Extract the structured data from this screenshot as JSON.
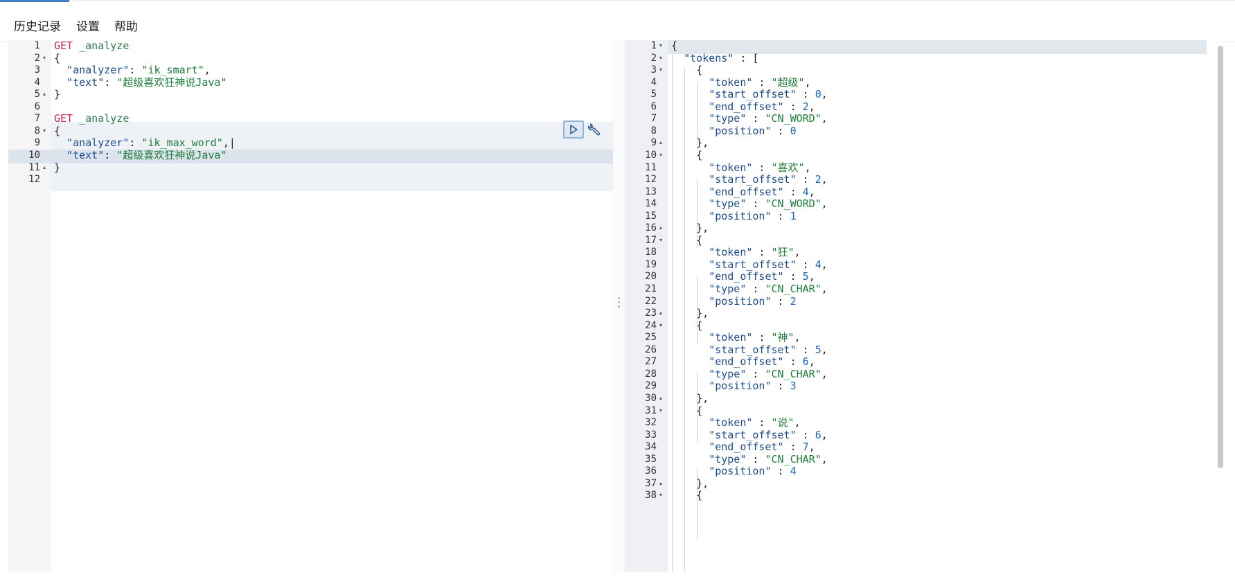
{
  "menu": {
    "history": "历史记录",
    "settings": "设置",
    "help": "帮助"
  },
  "request": {
    "lines": [
      {
        "n": "1",
        "fold": "",
        "tokens": [
          [
            "tk-method",
            "GET"
          ],
          [
            "tk-punc",
            " "
          ],
          [
            "tk-url",
            "_analyze"
          ]
        ]
      },
      {
        "n": "2",
        "fold": "▾",
        "tokens": [
          [
            "tk-punc",
            "{"
          ]
        ]
      },
      {
        "n": "3",
        "fold": "",
        "tokens": [
          [
            "tk-punc",
            "  "
          ],
          [
            "tk-key",
            "\"analyzer\""
          ],
          [
            "tk-punc",
            ": "
          ],
          [
            "tk-str",
            "\"ik_smart\""
          ],
          [
            "tk-punc",
            ","
          ]
        ]
      },
      {
        "n": "4",
        "fold": "",
        "tokens": [
          [
            "tk-punc",
            "  "
          ],
          [
            "tk-key",
            "\"text\""
          ],
          [
            "tk-punc",
            ": "
          ],
          [
            "tk-str",
            "\"超级喜欢狂神说Java\""
          ]
        ]
      },
      {
        "n": "5",
        "fold": "▴",
        "tokens": [
          [
            "tk-punc",
            "}"
          ]
        ]
      },
      {
        "n": "6",
        "fold": "",
        "tokens": []
      },
      {
        "n": "7",
        "fold": "",
        "tokens": [
          [
            "tk-method",
            "GET"
          ],
          [
            "tk-punc",
            " "
          ],
          [
            "tk-url",
            "_analyze"
          ]
        ]
      },
      {
        "n": "8",
        "fold": "▾",
        "tokens": [
          [
            "tk-punc",
            "{"
          ]
        ]
      },
      {
        "n": "9",
        "fold": "",
        "tokens": [
          [
            "tk-punc",
            "  "
          ],
          [
            "tk-key",
            "\"analyzer\""
          ],
          [
            "tk-punc",
            ": "
          ],
          [
            "tk-str",
            "\"ik_max_word\""
          ],
          [
            "tk-punc",
            ",|"
          ]
        ]
      },
      {
        "n": "10",
        "fold": "",
        "tokens": [
          [
            "tk-punc",
            "  "
          ],
          [
            "tk-key",
            "\"text\""
          ],
          [
            "tk-punc",
            ": "
          ],
          [
            "tk-str",
            "\"超级喜欢狂神说Java\""
          ]
        ]
      },
      {
        "n": "11",
        "fold": "▴",
        "tokens": [
          [
            "tk-punc",
            "}"
          ]
        ]
      },
      {
        "n": "12",
        "fold": "",
        "tokens": []
      }
    ]
  },
  "response": {
    "lines": [
      {
        "n": "1",
        "fold": "▾",
        "tokens": [
          [
            "tk-punc",
            "{"
          ]
        ]
      },
      {
        "n": "2",
        "fold": "▾",
        "tokens": [
          [
            "tk-punc",
            "  "
          ],
          [
            "tk-key",
            "\"tokens\""
          ],
          [
            "tk-punc",
            " : ["
          ]
        ]
      },
      {
        "n": "3",
        "fold": "▾",
        "tokens": [
          [
            "tk-punc",
            "    {"
          ]
        ]
      },
      {
        "n": "4",
        "fold": "",
        "tokens": [
          [
            "tk-punc",
            "      "
          ],
          [
            "tk-key",
            "\"token\""
          ],
          [
            "tk-punc",
            " : "
          ],
          [
            "tk-str",
            "\"超级\""
          ],
          [
            "tk-punc",
            ","
          ]
        ]
      },
      {
        "n": "5",
        "fold": "",
        "tokens": [
          [
            "tk-punc",
            "      "
          ],
          [
            "tk-key",
            "\"start_offset\""
          ],
          [
            "tk-punc",
            " : "
          ],
          [
            "tk-num",
            "0"
          ],
          [
            "tk-punc",
            ","
          ]
        ]
      },
      {
        "n": "6",
        "fold": "",
        "tokens": [
          [
            "tk-punc",
            "      "
          ],
          [
            "tk-key",
            "\"end_offset\""
          ],
          [
            "tk-punc",
            " : "
          ],
          [
            "tk-num",
            "2"
          ],
          [
            "tk-punc",
            ","
          ]
        ]
      },
      {
        "n": "7",
        "fold": "",
        "tokens": [
          [
            "tk-punc",
            "      "
          ],
          [
            "tk-key",
            "\"type\""
          ],
          [
            "tk-punc",
            " : "
          ],
          [
            "tk-str",
            "\"CN_WORD\""
          ],
          [
            "tk-punc",
            ","
          ]
        ]
      },
      {
        "n": "8",
        "fold": "",
        "tokens": [
          [
            "tk-punc",
            "      "
          ],
          [
            "tk-key",
            "\"position\""
          ],
          [
            "tk-punc",
            " : "
          ],
          [
            "tk-num",
            "0"
          ]
        ]
      },
      {
        "n": "9",
        "fold": "▴",
        "tokens": [
          [
            "tk-punc",
            "    },"
          ]
        ]
      },
      {
        "n": "10",
        "fold": "▾",
        "tokens": [
          [
            "tk-punc",
            "    {"
          ]
        ]
      },
      {
        "n": "11",
        "fold": "",
        "tokens": [
          [
            "tk-punc",
            "      "
          ],
          [
            "tk-key",
            "\"token\""
          ],
          [
            "tk-punc",
            " : "
          ],
          [
            "tk-str",
            "\"喜欢\""
          ],
          [
            "tk-punc",
            ","
          ]
        ]
      },
      {
        "n": "12",
        "fold": "",
        "tokens": [
          [
            "tk-punc",
            "      "
          ],
          [
            "tk-key",
            "\"start_offset\""
          ],
          [
            "tk-punc",
            " : "
          ],
          [
            "tk-num",
            "2"
          ],
          [
            "tk-punc",
            ","
          ]
        ]
      },
      {
        "n": "13",
        "fold": "",
        "tokens": [
          [
            "tk-punc",
            "      "
          ],
          [
            "tk-key",
            "\"end_offset\""
          ],
          [
            "tk-punc",
            " : "
          ],
          [
            "tk-num",
            "4"
          ],
          [
            "tk-punc",
            ","
          ]
        ]
      },
      {
        "n": "14",
        "fold": "",
        "tokens": [
          [
            "tk-punc",
            "      "
          ],
          [
            "tk-key",
            "\"type\""
          ],
          [
            "tk-punc",
            " : "
          ],
          [
            "tk-str",
            "\"CN_WORD\""
          ],
          [
            "tk-punc",
            ","
          ]
        ]
      },
      {
        "n": "15",
        "fold": "",
        "tokens": [
          [
            "tk-punc",
            "      "
          ],
          [
            "tk-key",
            "\"position\""
          ],
          [
            "tk-punc",
            " : "
          ],
          [
            "tk-num",
            "1"
          ]
        ]
      },
      {
        "n": "16",
        "fold": "▴",
        "tokens": [
          [
            "tk-punc",
            "    },"
          ]
        ]
      },
      {
        "n": "17",
        "fold": "▾",
        "tokens": [
          [
            "tk-punc",
            "    {"
          ]
        ]
      },
      {
        "n": "18",
        "fold": "",
        "tokens": [
          [
            "tk-punc",
            "      "
          ],
          [
            "tk-key",
            "\"token\""
          ],
          [
            "tk-punc",
            " : "
          ],
          [
            "tk-str",
            "\"狂\""
          ],
          [
            "tk-punc",
            ","
          ]
        ]
      },
      {
        "n": "19",
        "fold": "",
        "tokens": [
          [
            "tk-punc",
            "      "
          ],
          [
            "tk-key",
            "\"start_offset\""
          ],
          [
            "tk-punc",
            " : "
          ],
          [
            "tk-num",
            "4"
          ],
          [
            "tk-punc",
            ","
          ]
        ]
      },
      {
        "n": "20",
        "fold": "",
        "tokens": [
          [
            "tk-punc",
            "      "
          ],
          [
            "tk-key",
            "\"end_offset\""
          ],
          [
            "tk-punc",
            " : "
          ],
          [
            "tk-num",
            "5"
          ],
          [
            "tk-punc",
            ","
          ]
        ]
      },
      {
        "n": "21",
        "fold": "",
        "tokens": [
          [
            "tk-punc",
            "      "
          ],
          [
            "tk-key",
            "\"type\""
          ],
          [
            "tk-punc",
            " : "
          ],
          [
            "tk-str",
            "\"CN_CHAR\""
          ],
          [
            "tk-punc",
            ","
          ]
        ]
      },
      {
        "n": "22",
        "fold": "",
        "tokens": [
          [
            "tk-punc",
            "      "
          ],
          [
            "tk-key",
            "\"position\""
          ],
          [
            "tk-punc",
            " : "
          ],
          [
            "tk-num",
            "2"
          ]
        ]
      },
      {
        "n": "23",
        "fold": "▴",
        "tokens": [
          [
            "tk-punc",
            "    },"
          ]
        ]
      },
      {
        "n": "24",
        "fold": "▾",
        "tokens": [
          [
            "tk-punc",
            "    {"
          ]
        ]
      },
      {
        "n": "25",
        "fold": "",
        "tokens": [
          [
            "tk-punc",
            "      "
          ],
          [
            "tk-key",
            "\"token\""
          ],
          [
            "tk-punc",
            " : "
          ],
          [
            "tk-str",
            "\"神\""
          ],
          [
            "tk-punc",
            ","
          ]
        ]
      },
      {
        "n": "26",
        "fold": "",
        "tokens": [
          [
            "tk-punc",
            "      "
          ],
          [
            "tk-key",
            "\"start_offset\""
          ],
          [
            "tk-punc",
            " : "
          ],
          [
            "tk-num",
            "5"
          ],
          [
            "tk-punc",
            ","
          ]
        ]
      },
      {
        "n": "27",
        "fold": "",
        "tokens": [
          [
            "tk-punc",
            "      "
          ],
          [
            "tk-key",
            "\"end_offset\""
          ],
          [
            "tk-punc",
            " : "
          ],
          [
            "tk-num",
            "6"
          ],
          [
            "tk-punc",
            ","
          ]
        ]
      },
      {
        "n": "28",
        "fold": "",
        "tokens": [
          [
            "tk-punc",
            "      "
          ],
          [
            "tk-key",
            "\"type\""
          ],
          [
            "tk-punc",
            " : "
          ],
          [
            "tk-str",
            "\"CN_CHAR\""
          ],
          [
            "tk-punc",
            ","
          ]
        ]
      },
      {
        "n": "29",
        "fold": "",
        "tokens": [
          [
            "tk-punc",
            "      "
          ],
          [
            "tk-key",
            "\"position\""
          ],
          [
            "tk-punc",
            " : "
          ],
          [
            "tk-num",
            "3"
          ]
        ]
      },
      {
        "n": "30",
        "fold": "▴",
        "tokens": [
          [
            "tk-punc",
            "    },"
          ]
        ]
      },
      {
        "n": "31",
        "fold": "▾",
        "tokens": [
          [
            "tk-punc",
            "    {"
          ]
        ]
      },
      {
        "n": "32",
        "fold": "",
        "tokens": [
          [
            "tk-punc",
            "      "
          ],
          [
            "tk-key",
            "\"token\""
          ],
          [
            "tk-punc",
            " : "
          ],
          [
            "tk-str",
            "\"说\""
          ],
          [
            "tk-punc",
            ","
          ]
        ]
      },
      {
        "n": "33",
        "fold": "",
        "tokens": [
          [
            "tk-punc",
            "      "
          ],
          [
            "tk-key",
            "\"start_offset\""
          ],
          [
            "tk-punc",
            " : "
          ],
          [
            "tk-num",
            "6"
          ],
          [
            "tk-punc",
            ","
          ]
        ]
      },
      {
        "n": "34",
        "fold": "",
        "tokens": [
          [
            "tk-punc",
            "      "
          ],
          [
            "tk-key",
            "\"end_offset\""
          ],
          [
            "tk-punc",
            " : "
          ],
          [
            "tk-num",
            "7"
          ],
          [
            "tk-punc",
            ","
          ]
        ]
      },
      {
        "n": "35",
        "fold": "",
        "tokens": [
          [
            "tk-punc",
            "      "
          ],
          [
            "tk-key",
            "\"type\""
          ],
          [
            "tk-punc",
            " : "
          ],
          [
            "tk-str",
            "\"CN_CHAR\""
          ],
          [
            "tk-punc",
            ","
          ]
        ]
      },
      {
        "n": "36",
        "fold": "",
        "tokens": [
          [
            "tk-punc",
            "      "
          ],
          [
            "tk-key",
            "\"position\""
          ],
          [
            "tk-punc",
            " : "
          ],
          [
            "tk-num",
            "4"
          ]
        ]
      },
      {
        "n": "37",
        "fold": "▴",
        "tokens": [
          [
            "tk-punc",
            "    },"
          ]
        ]
      },
      {
        "n": "38",
        "fold": "▾",
        "tokens": [
          [
            "tk-punc",
            "    {"
          ]
        ]
      }
    ]
  },
  "icons": {
    "run": "play-icon",
    "tools": "wrench-icon",
    "splitter": "vertical-ellipsis-icon"
  },
  "colors": {
    "accent": "#3f7ec4",
    "method": "#c7254e",
    "string": "#1d7d3a",
    "number": "#1664b8"
  }
}
